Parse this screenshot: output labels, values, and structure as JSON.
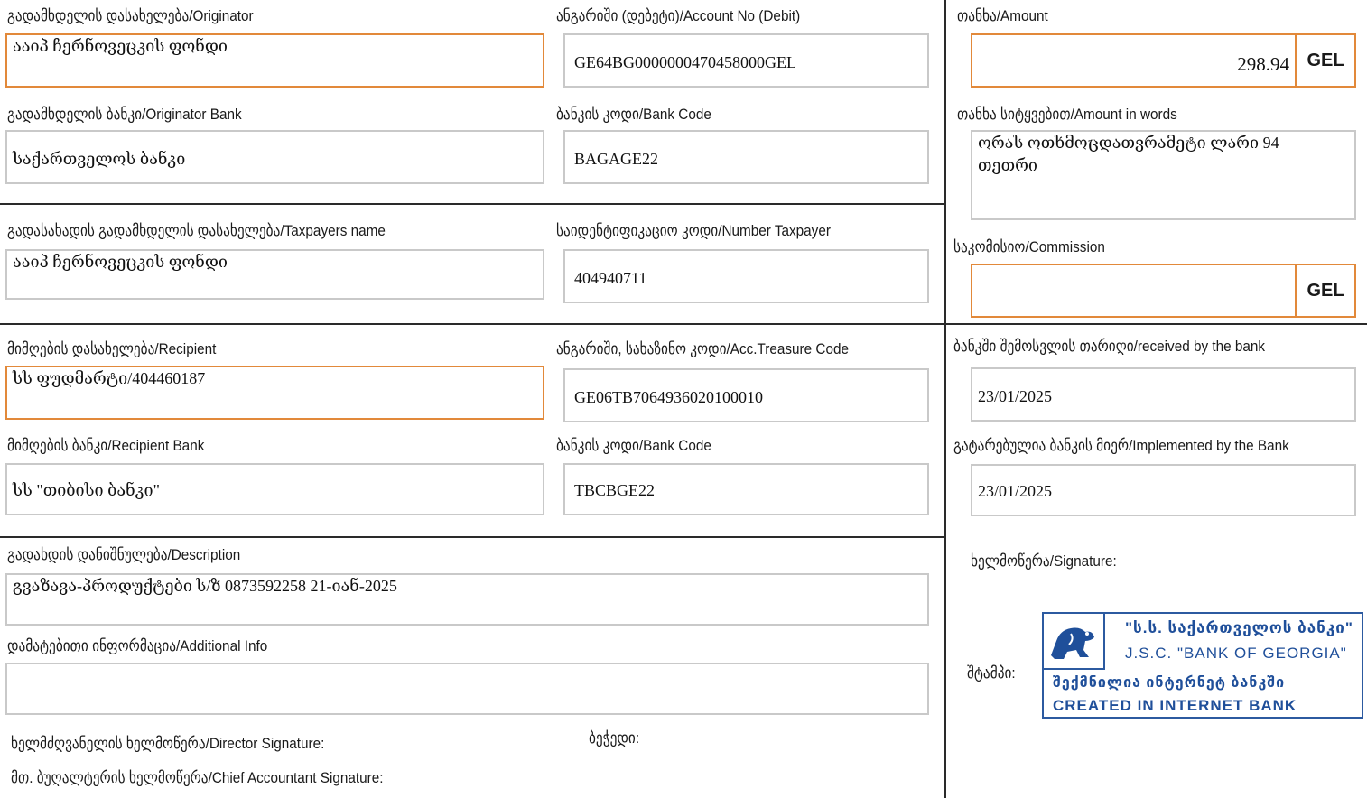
{
  "originator": {
    "label": "გადამხდელის დასახელება/Originator",
    "value": "ააიპ ჩერნოვეცკის ფონდი"
  },
  "account_debit": {
    "label": "ანგარიში (დებეტი)/Account No (Debit)",
    "value": "GE64BG0000000470458000GEL"
  },
  "amount": {
    "label": "თანხა/Amount",
    "value": "298.94",
    "currency": "GEL"
  },
  "originator_bank": {
    "label": "გადამხდელის ბანკი/Originator Bank",
    "value": "საქართველოს ბანკი"
  },
  "originator_bank_code": {
    "label": "ბანკის კოდი/Bank Code",
    "value": "BAGAGE22"
  },
  "amount_words": {
    "label": "თანხა სიტყვებით/Amount in words",
    "line1": "ორას ოთხმოცდათვრამეტი ლარი 94",
    "line2": "თეთრი"
  },
  "taxpayer_name": {
    "label": "გადასახადის გადამხდელის დასახელება/Taxpayers name",
    "value": "ააიპ ჩერნოვეცკის ფონდი"
  },
  "taxpayer_number": {
    "label": "საიდენტიფიკაციო კოდი/Number Taxpayer",
    "value": "404940711"
  },
  "commission": {
    "label": "საკომისიო/Commission",
    "value": "",
    "currency": "GEL"
  },
  "recipient": {
    "label": "მიმღების დასახელება/Recipient",
    "value": "სს ფუდმარტი/404460187"
  },
  "treasury_code": {
    "label": "ანგარიში, სახაზინო კოდი/Acc.Treasure Code",
    "value": "GE06TB7064936020100010"
  },
  "received_by_bank": {
    "label": "ბანკში შემოსვლის თარიღი/received by the bank",
    "value": "23/01/2025"
  },
  "recipient_bank": {
    "label": "მიმღების ბანკი/Recipient Bank",
    "value": "სს \"თიბისი  ბანკი\""
  },
  "recipient_bank_code": {
    "label": "ბანკის კოდი/Bank Code",
    "value": "TBCBGE22"
  },
  "implemented_by_bank": {
    "label": "გატარებულია ბანკის მიერ/Implemented by the Bank",
    "value": "23/01/2025"
  },
  "description": {
    "label": "გადახდის დანიშნულება/Description",
    "value": "გვაზავა-პროდუქტები ს/ზ 0873592258 21-იან-2025"
  },
  "additional_info": {
    "label": "დამატებითი ინფორმაცია/Additional Info",
    "value": ""
  },
  "bank_signature": {
    "label": "ხელმოწერა/Signature:"
  },
  "director_signature": {
    "label": "ხელმძღვანელის ხელმოწერა/Director Signature:"
  },
  "seal": {
    "label": "ბეჭედი:"
  },
  "chief_accountant_signature": {
    "label": "მთ. ბუღალტერის ხელმოწერა/Chief Accountant Signature:"
  },
  "stamp": {
    "label": "შტამპი:",
    "line1": "\"ს.ს.  საქართველოს ბანკი\"",
    "line2": "J.S.C.  \"BANK OF GEORGIA\"",
    "line3": "შექმნილია ინტერნეტ ბანკში",
    "line4": "CREATED IN INTERNET BANK",
    "ink_color": "#1f4f9a"
  },
  "colors": {
    "highlight_border": "#e2893a",
    "field_border": "#c9c9c9",
    "divider": "#2a2a2a"
  }
}
